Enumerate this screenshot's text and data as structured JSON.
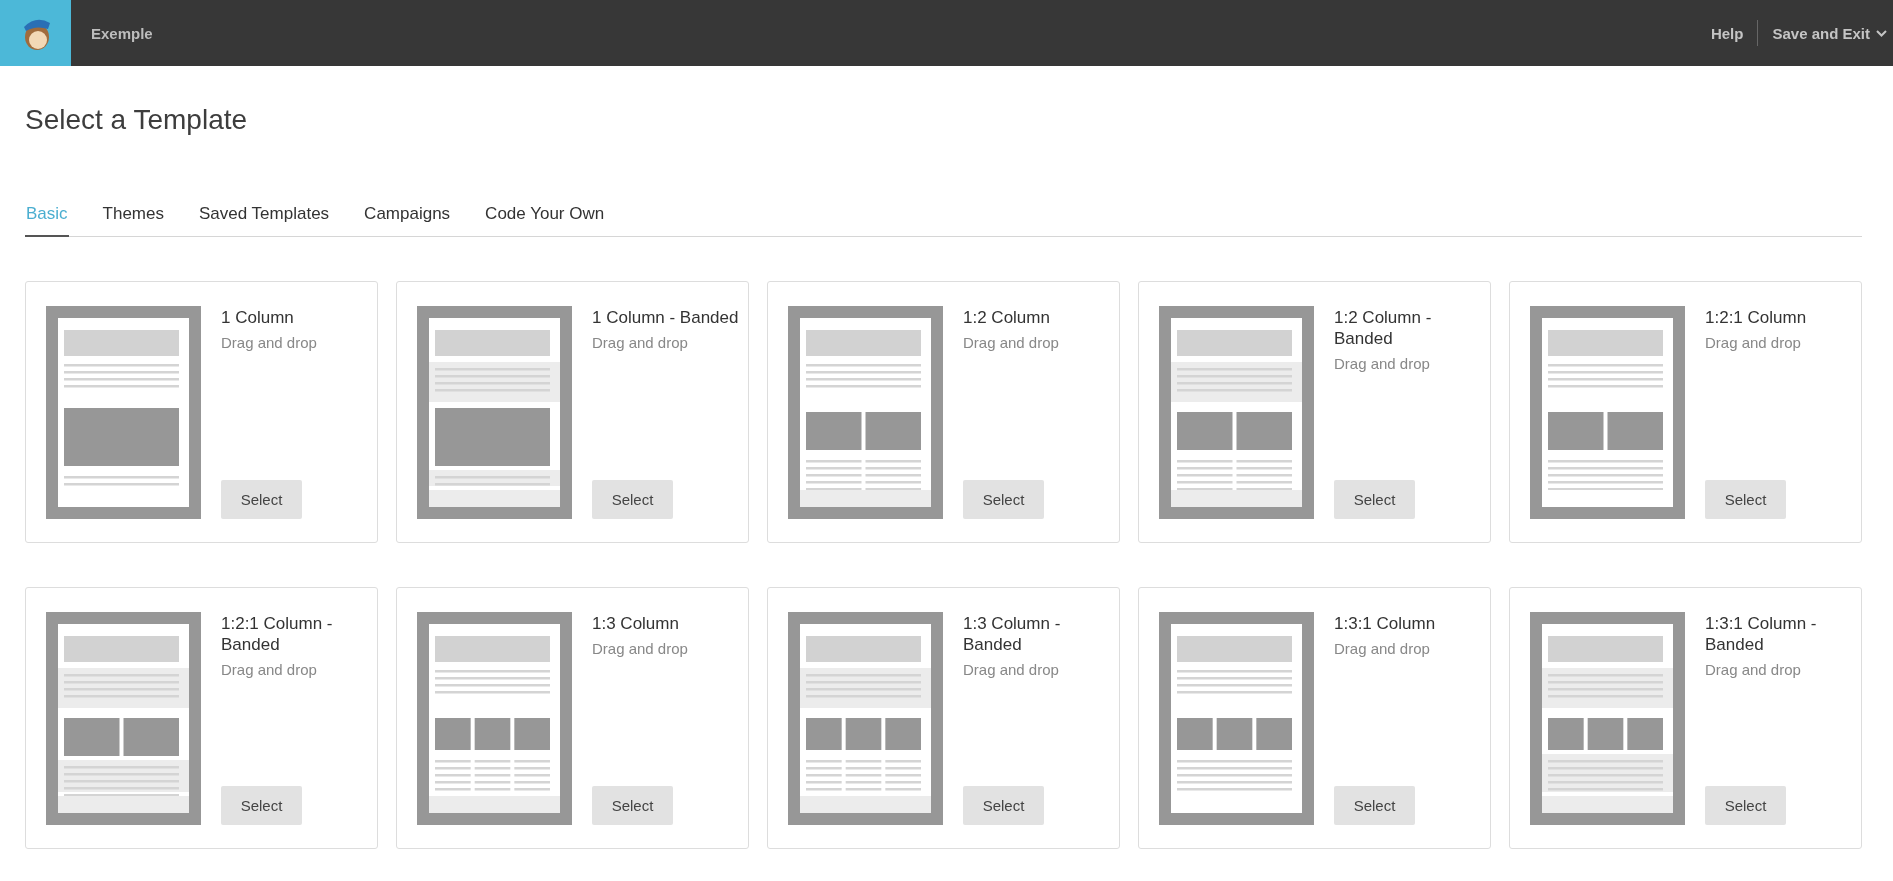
{
  "top_bar": {
    "campaign_name": "Exemple",
    "help": "Help",
    "save_menu": "Save and Exit"
  },
  "page_title": "Select a Template",
  "tabs": [
    {
      "label": "Basic",
      "selected": true
    },
    {
      "label": "Themes",
      "selected": false
    },
    {
      "label": "Saved Templates",
      "selected": false
    },
    {
      "label": "Campaigns",
      "selected": false
    },
    {
      "label": "Code Your Own",
      "selected": false
    }
  ],
  "templates": [
    {
      "name": "1 Column",
      "subtitle": "Drag and drop",
      "kind": "one",
      "banded": false,
      "button": "Select"
    },
    {
      "name": "1 Column - Banded",
      "subtitle": "Drag and drop",
      "kind": "one",
      "banded": true,
      "button": "Select"
    },
    {
      "name": "1:2 Column",
      "subtitle": "Drag and drop",
      "kind": "two",
      "banded": false,
      "button": "Select"
    },
    {
      "name": "1:2 Column - Banded",
      "subtitle": "Drag and drop",
      "kind": "two",
      "banded": true,
      "button": "Select"
    },
    {
      "name": "1:2:1 Column",
      "subtitle": "Drag and drop",
      "kind": "twoone",
      "banded": false,
      "button": "Select"
    },
    {
      "name": "1:2:1 Column - Banded",
      "subtitle": "Drag and drop",
      "kind": "twoone",
      "banded": true,
      "button": "Select"
    },
    {
      "name": "1:3 Column",
      "subtitle": "Drag and drop",
      "kind": "three",
      "banded": false,
      "button": "Select"
    },
    {
      "name": "1:3 Column - Banded",
      "subtitle": "Drag and drop",
      "kind": "three",
      "banded": true,
      "button": "Select"
    },
    {
      "name": "1:3:1 Column",
      "subtitle": "Drag and drop",
      "kind": "threeone",
      "banded": false,
      "button": "Select"
    },
    {
      "name": "1:3:1 Column - Banded",
      "subtitle": "Drag and drop",
      "kind": "threeone",
      "banded": true,
      "button": "Select"
    }
  ]
}
